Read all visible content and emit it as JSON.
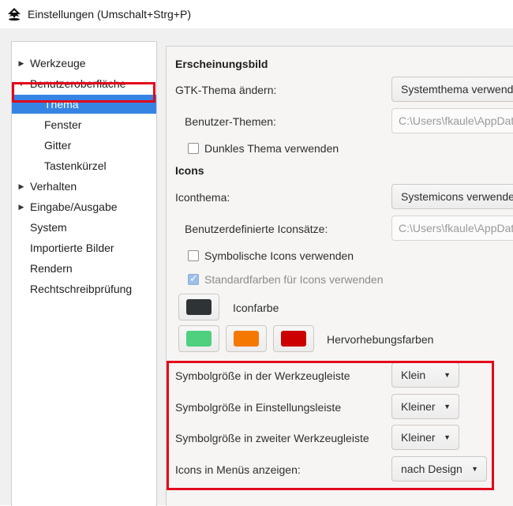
{
  "window": {
    "title": "Einstellungen (Umschalt+Strg+P)",
    "app_icon": "inkscape-logo-icon"
  },
  "sidebar": {
    "items": [
      {
        "label": "Werkzeuge",
        "expander": "collapsed"
      },
      {
        "label": "Benutzeroberfläche",
        "expander": "expanded"
      },
      {
        "label": "Thema",
        "selected": true
      },
      {
        "label": "Fenster"
      },
      {
        "label": "Gitter"
      },
      {
        "label": "Tastenkürzel"
      },
      {
        "label": "Verhalten",
        "expander": "collapsed"
      },
      {
        "label": "Eingabe/Ausgabe",
        "expander": "collapsed"
      },
      {
        "label": "System"
      },
      {
        "label": "Importierte Bilder"
      },
      {
        "label": "Rendern"
      },
      {
        "label": "Rechtschreibprüfung"
      }
    ]
  },
  "appearance": {
    "heading": "Erscheinungsbild",
    "gtk_theme_label": "GTK-Thema ändern:",
    "gtk_theme_value": "Systemthema verwenden",
    "user_themes_label": "Benutzer-Themen:",
    "user_themes_path": "C:\\Users\\fkaule\\AppData",
    "dark_theme_label": "Dunkles Thema verwenden",
    "dark_theme_checked": false
  },
  "icons": {
    "heading": "Icons",
    "icon_theme_label": "Iconthema:",
    "icon_theme_value": "Systemicons verwenden",
    "custom_iconsets_label": "Benutzerdefinierte Iconsätze:",
    "custom_iconsets_path": "C:\\Users\\fkaule\\AppData",
    "symbolic_label": "Symbolische Icons verwenden",
    "symbolic_checked": false,
    "default_colors_label": "Standardfarben für Icons verwenden",
    "default_colors_checked": true,
    "icon_color_label": "Iconfarbe",
    "icon_color": "#2e3436",
    "highlight_label": "Hervorhebungsfarben",
    "highlight_colors": [
      "#4ed07e",
      "#f57900",
      "#cc0000"
    ]
  },
  "sizes": {
    "toolbar_label": "Symbolgröße in der Werkzeugleiste",
    "toolbar_value": "Klein",
    "settings_bar_label": "Symbolgröße in Einstellungsleiste",
    "settings_bar_value": "Kleiner",
    "second_toolbar_label": "Symbolgröße in zweiter Werkzeugleiste",
    "second_toolbar_value": "Kleiner",
    "menu_icons_label": "Icons in Menüs anzeigen:",
    "menu_icons_value": "nach Design"
  },
  "colors": {
    "selection": "#3584e4",
    "annotation_red": "#e3061a"
  }
}
